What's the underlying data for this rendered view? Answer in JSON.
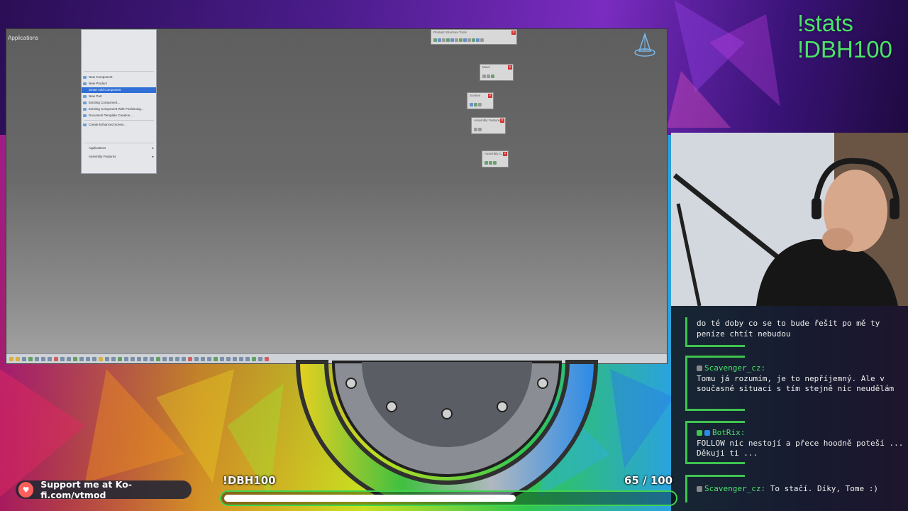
{
  "overlay": {
    "stats_line1": "!stats",
    "stats_line2": "!DBH100"
  },
  "cad": {
    "title": "Applications",
    "context_menu": {
      "items": [
        {
          "label": "New Component",
          "state": "normal"
        },
        {
          "label": "New Product",
          "state": "normal"
        },
        {
          "label": "Smart Add Component",
          "state": "highlighted"
        },
        {
          "label": "New Part",
          "state": "normal"
        },
        {
          "label": "Existing Component...",
          "state": "normal"
        },
        {
          "label": "Existing Component With Positioning...",
          "state": "normal"
        },
        {
          "label": "Document Template Creation...",
          "state": "normal"
        },
        {
          "label": "Create Enhanced Scene...",
          "state": "normal"
        },
        {
          "label": "Applications",
          "state": "submenu"
        },
        {
          "label": "Assembly Features",
          "state": "submenu"
        }
      ]
    },
    "toolbars": [
      {
        "title": "Product Structure Tools"
      },
      {
        "title": "Move"
      },
      {
        "title": "Scenes"
      },
      {
        "title": "Assembly Features"
      },
      {
        "title": "Assembly C..."
      }
    ]
  },
  "chat": {
    "messages": [
      {
        "user": "",
        "text": "do té doby co se to bude řešit po mě ty peníze chtít nebudou"
      },
      {
        "user": "Scavenger_cz:",
        "text": "Tomu já rozumím, je to nepříjemný. Ale v současné situaci s tím stejně nic neudělám"
      },
      {
        "user": "BotRix:",
        "text": "FOLLOW nic nestojí a přece hoodně poteší ... Děkuji ti ..."
      },
      {
        "user": "Scavenger_cz:",
        "text": "To stačí. Díky, Tome :)"
      }
    ]
  },
  "goal": {
    "label": "!DBH100",
    "current": "65",
    "separator": " / ",
    "total": "100",
    "progress_fraction": 0.65
  },
  "kofi": {
    "text": "Support me at Ko-fi.com/vtmod"
  },
  "colors": {
    "accent_green": "#4be36a",
    "highlight_blue": "#2f6fd6",
    "kofi_red": "#ff5e5b"
  }
}
